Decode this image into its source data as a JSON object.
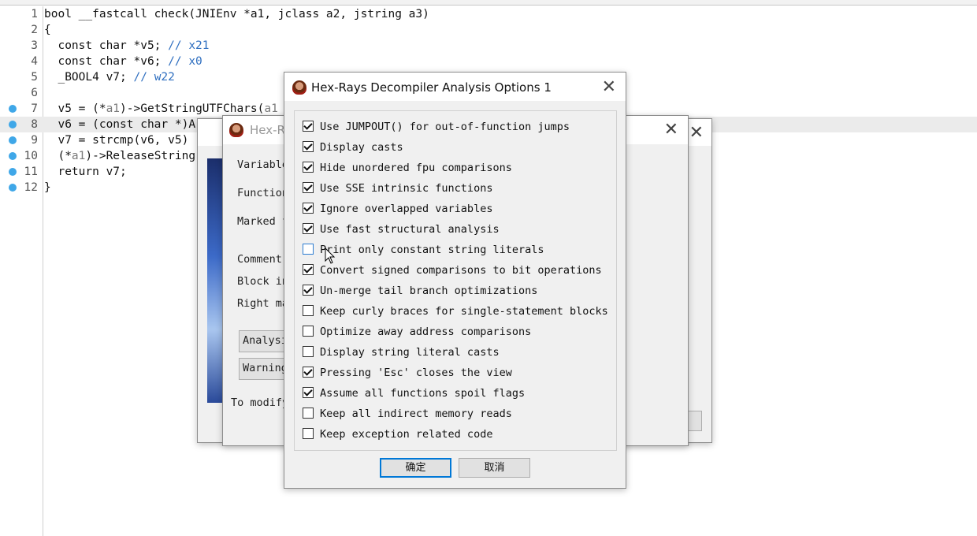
{
  "editor": {
    "lines": [
      {
        "n": "1",
        "segs": [
          {
            "t": "bool __fastcall check(JNIEnv *a1, jclass a2, jstring a3)",
            "c": ""
          }
        ],
        "bp": false,
        "hl": false
      },
      {
        "n": "2",
        "segs": [
          {
            "t": "{",
            "c": ""
          }
        ],
        "bp": false,
        "hl": false
      },
      {
        "n": "3",
        "segs": [
          {
            "t": "  const char *v5; ",
            "c": ""
          },
          {
            "t": "// x21",
            "c": "cm"
          }
        ],
        "bp": false,
        "hl": false
      },
      {
        "n": "4",
        "segs": [
          {
            "t": "  const char *v6; ",
            "c": ""
          },
          {
            "t": "// x0",
            "c": "cm"
          }
        ],
        "bp": false,
        "hl": false
      },
      {
        "n": "5",
        "segs": [
          {
            "t": "  _BOOL4 v7; ",
            "c": ""
          },
          {
            "t": "// w22",
            "c": "cm"
          }
        ],
        "bp": false,
        "hl": false
      },
      {
        "n": "6",
        "segs": [
          {
            "t": "",
            "c": ""
          }
        ],
        "bp": false,
        "hl": false
      },
      {
        "n": "7",
        "segs": [
          {
            "t": "  v5 = (*",
            "c": ""
          },
          {
            "t": "a1",
            "c": "var"
          },
          {
            "t": ")->GetStringUTFChars(",
            "c": ""
          },
          {
            "t": "a1",
            "c": "var"
          }
        ],
        "bp": true,
        "hl": false
      },
      {
        "n": "8",
        "segs": [
          {
            "t": "  v6 = (const char *)A",
            "c": ""
          }
        ],
        "bp": true,
        "hl": true
      },
      {
        "n": "9",
        "segs": [
          {
            "t": "  v7 = strcmp(v6, v5)",
            "c": ""
          }
        ],
        "bp": true,
        "hl": false
      },
      {
        "n": "10",
        "segs": [
          {
            "t": "  (*",
            "c": ""
          },
          {
            "t": "a1",
            "c": "var"
          },
          {
            "t": ")->ReleaseString",
            "c": ""
          }
        ],
        "bp": true,
        "hl": false
      },
      {
        "n": "11",
        "segs": [
          {
            "t": "  return v7;",
            "c": ""
          }
        ],
        "bp": true,
        "hl": false
      },
      {
        "n": "12",
        "segs": [
          {
            "t": "}",
            "c": ""
          }
        ],
        "bp": true,
        "hl": false
      }
    ]
  },
  "bg_dialog": {
    "title": "Hex-R",
    "labels": [
      "Variable",
      "Function",
      "Marked f",
      "Comment",
      "Block in",
      "Right ma"
    ],
    "analysis_button": "Analysi",
    "warnings_button": "Warning",
    "footer": "To modify"
  },
  "main_dialog": {
    "title": "Hex-Rays Decompiler Analysis Options 1",
    "close_icon": "close-icon",
    "options": [
      {
        "label": "Use JUMPOUT() for out-of-function jumps",
        "checked": true
      },
      {
        "label": "Display casts",
        "checked": true
      },
      {
        "label": "Hide unordered fpu comparisons",
        "checked": true
      },
      {
        "label": "Use SSE intrinsic functions",
        "checked": true
      },
      {
        "label": "Ignore overlapped variables",
        "checked": true
      },
      {
        "label": "Use fast structural analysis",
        "checked": true
      },
      {
        "label": "Print only constant string literals",
        "checked": false
      },
      {
        "label": "Convert signed comparisons to bit operations",
        "checked": true
      },
      {
        "label": "Un-merge tail branch optimizations",
        "checked": true
      },
      {
        "label": "Keep curly braces for single-statement blocks",
        "checked": false
      },
      {
        "label": "Optimize away address comparisons",
        "checked": false
      },
      {
        "label": "Display string literal casts",
        "checked": false
      },
      {
        "label": "Pressing 'Esc' closes the view",
        "checked": true
      },
      {
        "label": "Assume all functions spoil flags",
        "checked": true
      },
      {
        "label": "Keep all indirect memory reads",
        "checked": false
      },
      {
        "label": "Keep exception related code",
        "checked": false
      }
    ],
    "ok_label": "确定",
    "cancel_label": "取消"
  },
  "colors": {
    "accent": "#0078d7",
    "breakpoint": "#3fa7e8",
    "comment": "#2f6fc0"
  }
}
